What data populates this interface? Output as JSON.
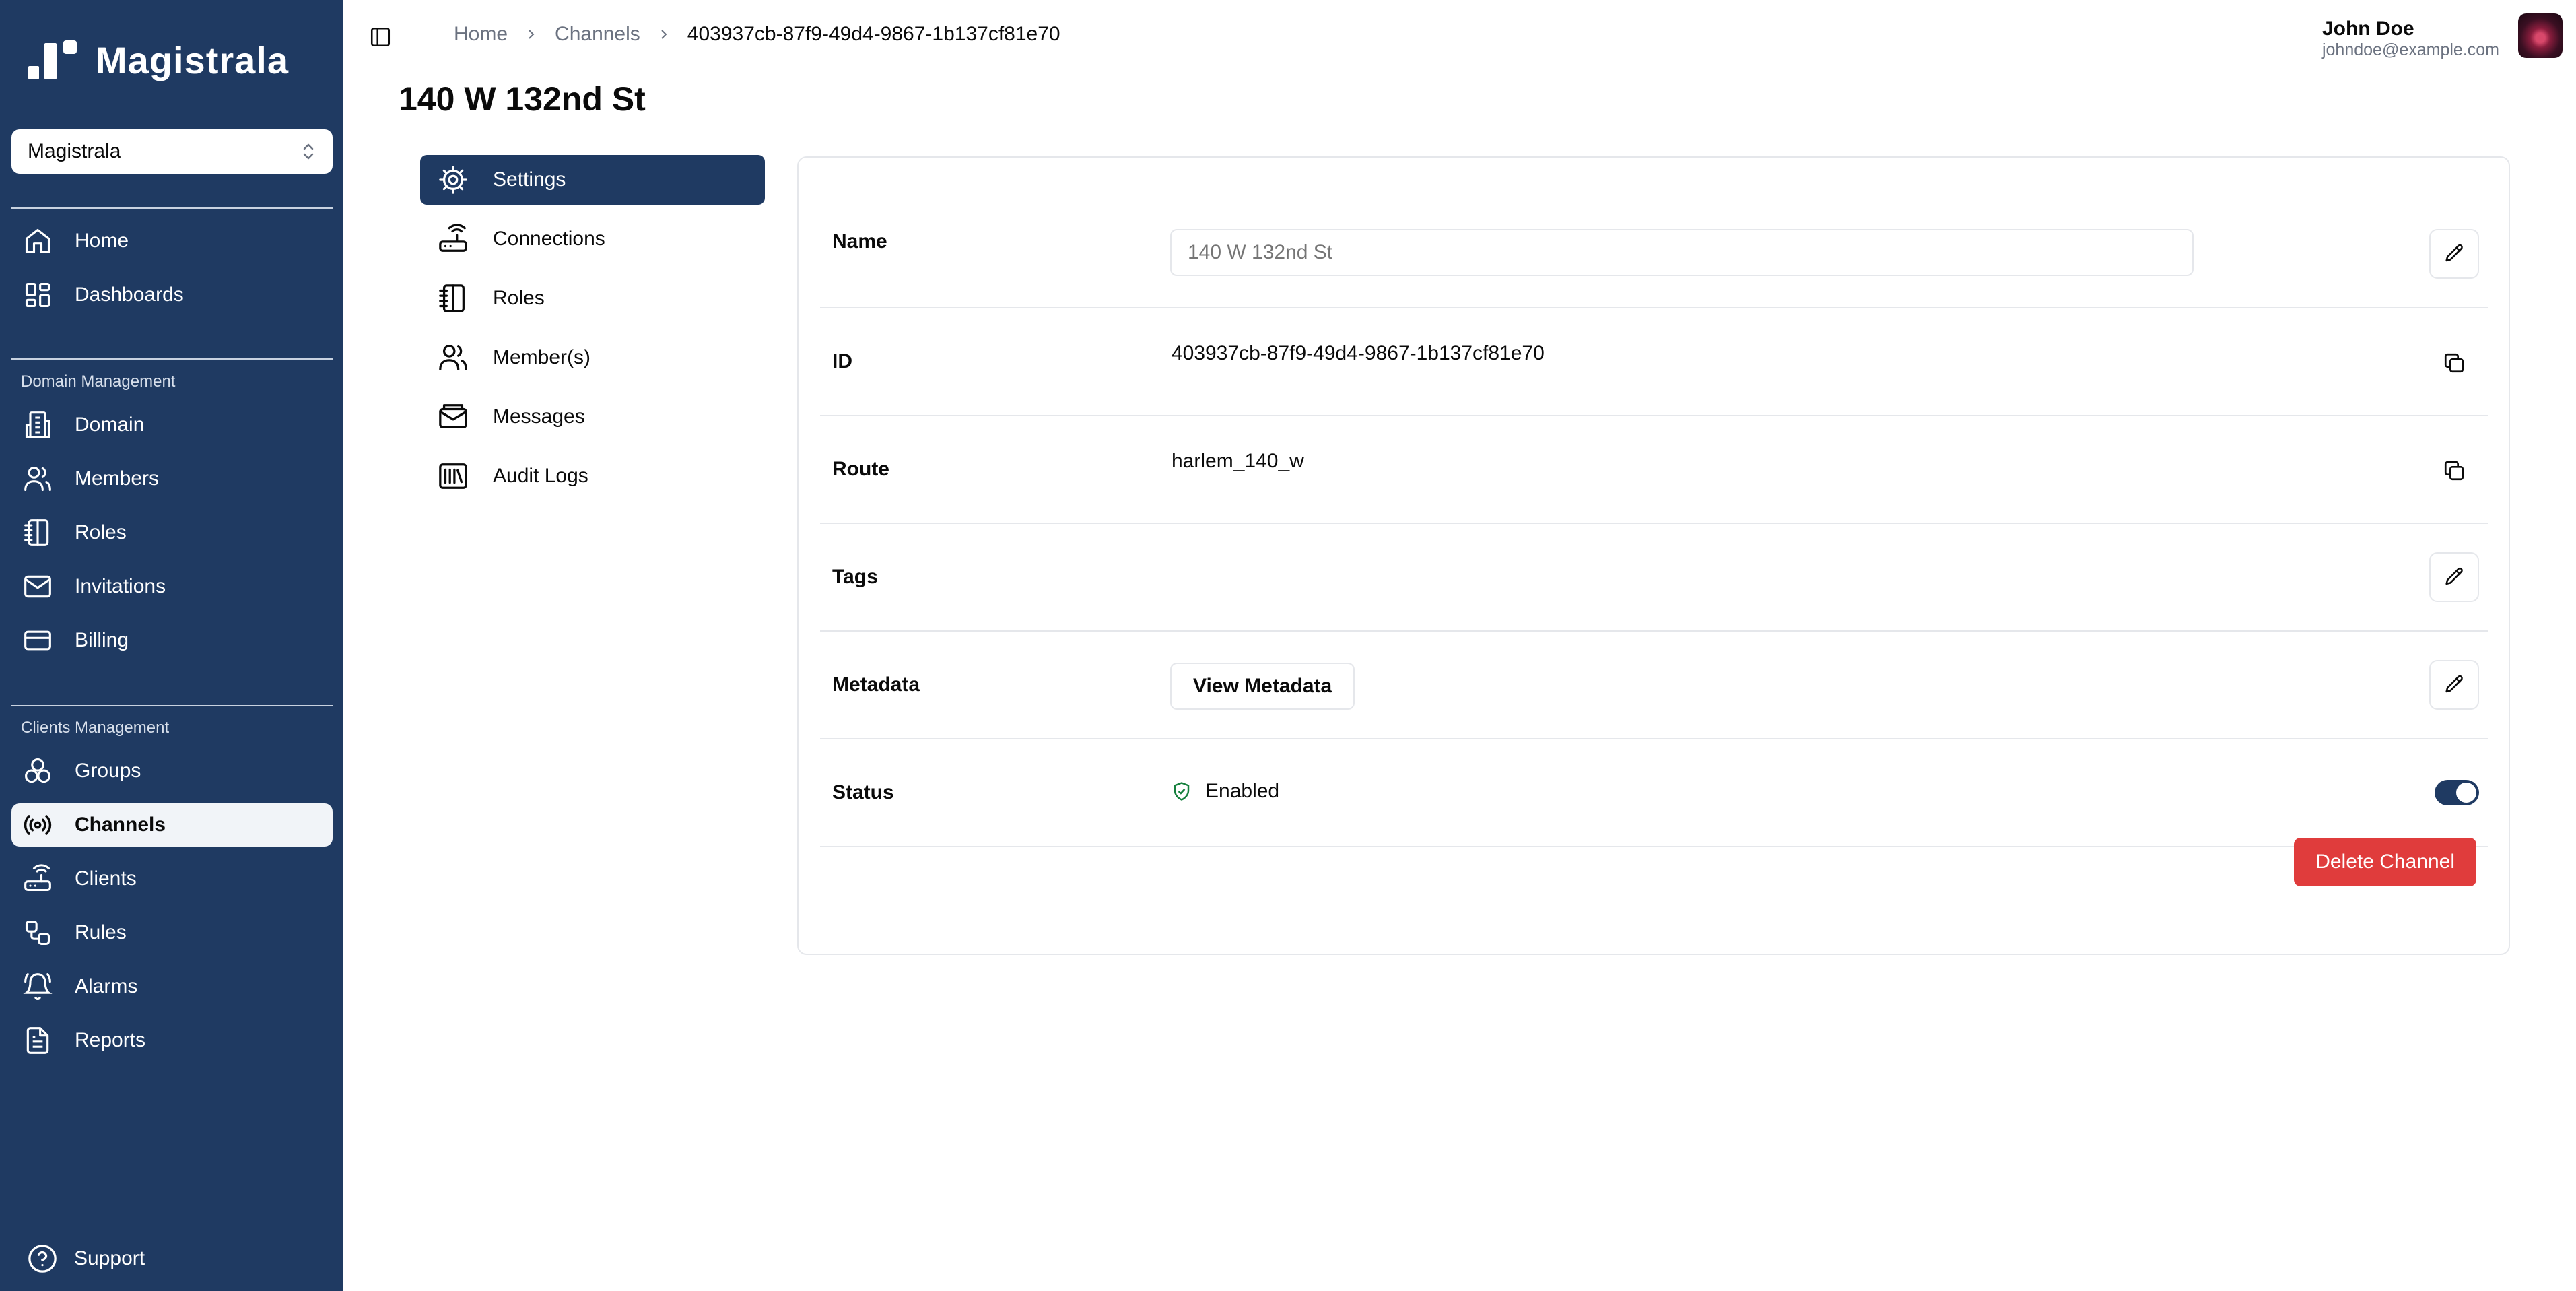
{
  "app": {
    "name": "Magistrala"
  },
  "domain_selector": {
    "value": "Magistrala"
  },
  "sidebar": {
    "main": [
      {
        "label": "Home",
        "icon": "home-icon"
      },
      {
        "label": "Dashboards",
        "icon": "dashboard-icon"
      }
    ],
    "domain_management": {
      "title": "Domain Management",
      "items": [
        {
          "label": "Domain",
          "icon": "building-icon"
        },
        {
          "label": "Members",
          "icon": "users-icon"
        },
        {
          "label": "Roles",
          "icon": "notebook-icon"
        },
        {
          "label": "Invitations",
          "icon": "mail-icon"
        },
        {
          "label": "Billing",
          "icon": "credit-card-icon"
        }
      ]
    },
    "clients_management": {
      "title": "Clients Management",
      "items": [
        {
          "label": "Groups",
          "icon": "groups-icon"
        },
        {
          "label": "Channels",
          "icon": "radio-icon",
          "active": true
        },
        {
          "label": "Clients",
          "icon": "router-icon"
        },
        {
          "label": "Rules",
          "icon": "workflow-icon"
        },
        {
          "label": "Alarms",
          "icon": "bell-icon"
        },
        {
          "label": "Reports",
          "icon": "file-text-icon"
        }
      ]
    },
    "support": "Support"
  },
  "breadcrumb": {
    "home": "Home",
    "channels": "Channels",
    "current": "403937cb-87f9-49d4-9867-1b137cf81e70"
  },
  "user": {
    "name": "John Doe",
    "email": "johndoe@example.com"
  },
  "page": {
    "title": "140 W 132nd St"
  },
  "tabs": [
    {
      "label": "Settings",
      "icon": "settings-icon",
      "active": true
    },
    {
      "label": "Connections",
      "icon": "router-icon"
    },
    {
      "label": "Roles",
      "icon": "notebook-icon"
    },
    {
      "label": "Member(s)",
      "icon": "users-icon"
    },
    {
      "label": "Messages",
      "icon": "mail-open-icon"
    },
    {
      "label": "Audit Logs",
      "icon": "library-icon"
    }
  ],
  "settings": {
    "name": {
      "label": "Name",
      "placeholder": "140 W 132nd St"
    },
    "id": {
      "label": "ID",
      "value": "403937cb-87f9-49d4-9867-1b137cf81e70"
    },
    "route": {
      "label": "Route",
      "value": "harlem_140_w"
    },
    "tags": {
      "label": "Tags"
    },
    "metadata": {
      "label": "Metadata",
      "button": "View Metadata"
    },
    "status": {
      "label": "Status",
      "value": "Enabled",
      "enabled": true
    },
    "delete_button": "Delete Channel"
  },
  "colors": {
    "sidebar": "#1f3a62",
    "danger": "#e03c3c",
    "active_tab": "#1f3a62"
  }
}
